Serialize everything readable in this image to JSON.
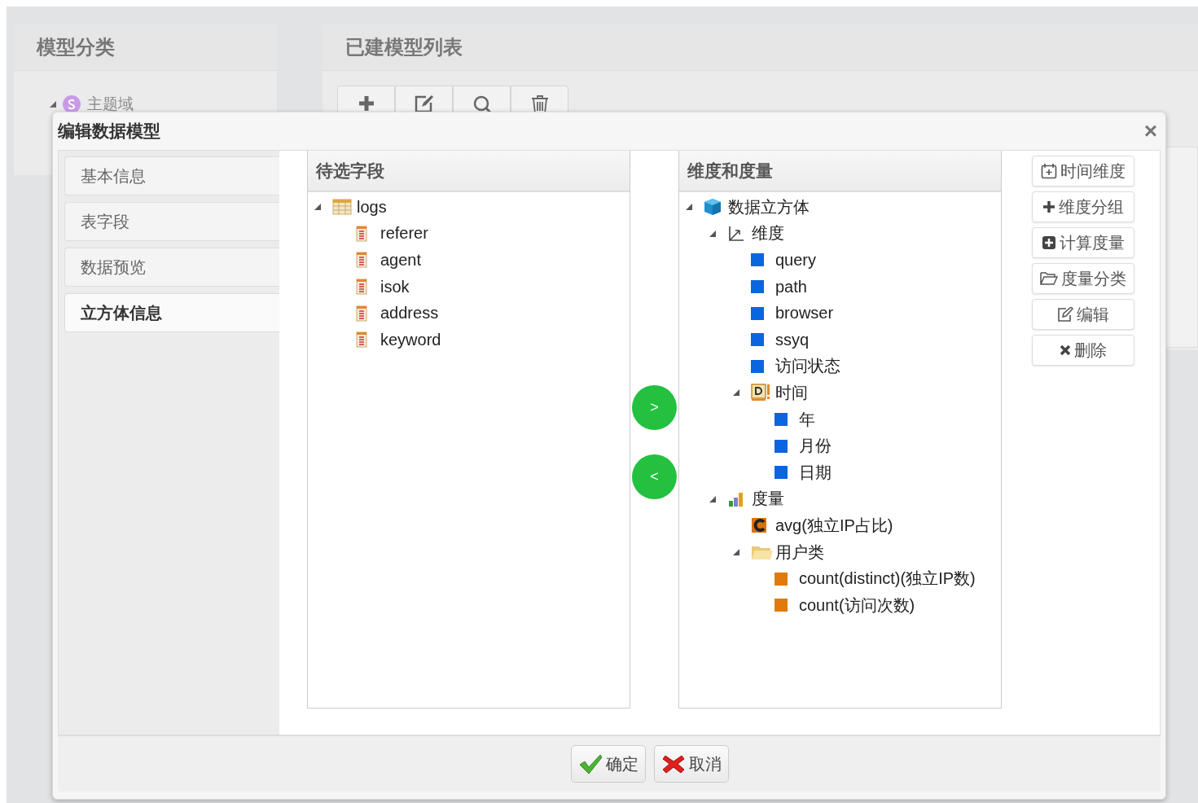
{
  "background": {
    "category_panel": {
      "title": "模型分类",
      "tree": [
        {
          "label": "主题域",
          "expanded": true
        }
      ]
    },
    "model_list_panel": {
      "title": "已建模型列表",
      "toolbar": [
        {
          "kind": "add"
        },
        {
          "kind": "edit"
        },
        {
          "kind": "search"
        },
        {
          "kind": "delete"
        }
      ]
    }
  },
  "dialog": {
    "title": "编辑数据模型",
    "close": "×",
    "nav": [
      {
        "label": "基本信息",
        "selected": false
      },
      {
        "label": "表字段",
        "selected": false
      },
      {
        "label": "数据预览",
        "selected": false
      },
      {
        "label": "立方体信息",
        "selected": true
      }
    ],
    "fields_panel": {
      "title": "待选字段",
      "tree": [
        {
          "label": "logs",
          "kind": "table",
          "expanded": true,
          "children": [
            {
              "label": "referer",
              "kind": "field"
            },
            {
              "label": "agent",
              "kind": "field"
            },
            {
              "label": "isok",
              "kind": "field"
            },
            {
              "label": "address",
              "kind": "field"
            },
            {
              "label": "keyword",
              "kind": "field"
            }
          ]
        }
      ]
    },
    "move_buttons": [
      ">",
      "<"
    ],
    "cube_panel": {
      "title": "维度和度量",
      "tree": [
        {
          "label": "数据立方体",
          "kind": "cube",
          "expanded": true,
          "children": [
            {
              "label": "维度",
              "kind": "axes",
              "expanded": true,
              "children": [
                {
                  "label": "query",
                  "kind": "dimension"
                },
                {
                  "label": "path",
                  "kind": "dimension"
                },
                {
                  "label": "browser",
                  "kind": "dimension"
                },
                {
                  "label": "ssyq",
                  "kind": "dimension"
                },
                {
                  "label": "访问状态",
                  "kind": "dimension"
                },
                {
                  "label": "时间",
                  "kind": "date",
                  "expanded": true,
                  "children": [
                    {
                      "label": "年",
                      "kind": "dimension"
                    },
                    {
                      "label": "月份",
                      "kind": "dimension"
                    },
                    {
                      "label": "日期",
                      "kind": "dimension"
                    }
                  ]
                }
              ]
            },
            {
              "label": "度量",
              "kind": "bars",
              "expanded": true,
              "children": [
                {
                  "label": "avg(独立IP占比)",
                  "kind": "calc"
                },
                {
                  "label": "用户类",
                  "kind": "folder",
                  "expanded": true,
                  "children": [
                    {
                      "label": "count(distinct)(独立IP数)",
                      "kind": "measure"
                    },
                    {
                      "label": "count(访问次数)",
                      "kind": "measure"
                    }
                  ]
                }
              ]
            }
          ]
        }
      ]
    },
    "side_buttons": [
      {
        "label": "时间维度",
        "kind": "calendar"
      },
      {
        "label": "维度分组",
        "kind": "plus"
      },
      {
        "label": "计算度量",
        "kind": "plus-square"
      },
      {
        "label": "度量分类",
        "kind": "folder"
      },
      {
        "label": "编辑",
        "kind": "edit"
      },
      {
        "label": "删除",
        "kind": "delete"
      }
    ],
    "footer_buttons": [
      {
        "label": "确定",
        "kind": "ok"
      },
      {
        "label": "取消",
        "kind": "cancel"
      }
    ]
  }
}
